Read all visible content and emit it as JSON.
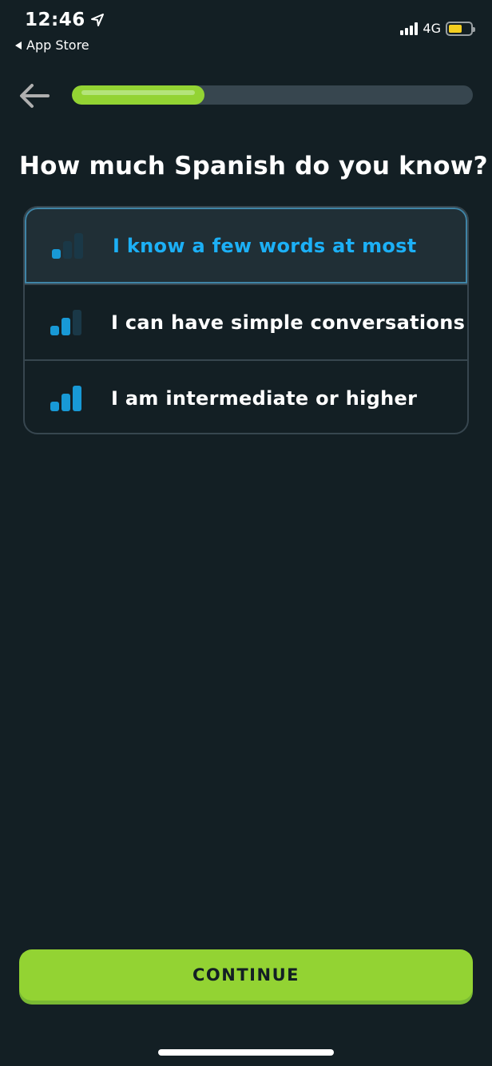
{
  "status_bar": {
    "time": "12:46",
    "back_to_app": "App Store",
    "network": "4G",
    "battery_level": 0.6
  },
  "header": {
    "progress": 0.33
  },
  "question": "How much Spanish do you know?",
  "options": [
    {
      "label": "I know a few words at most",
      "level": 1,
      "selected": true
    },
    {
      "label": "I can have simple conversations",
      "level": 2,
      "selected": false
    },
    {
      "label": "I am intermediate or higher",
      "level": 3,
      "selected": false
    }
  ],
  "continue_button": {
    "label": "CONTINUE"
  },
  "colors": {
    "background": "#131f24",
    "accent_green": "#93d333",
    "accent_blue": "#1cb0f6",
    "bar_active": "#1899d6",
    "bar_inactive": "#1a3847",
    "border": "#37464f"
  }
}
